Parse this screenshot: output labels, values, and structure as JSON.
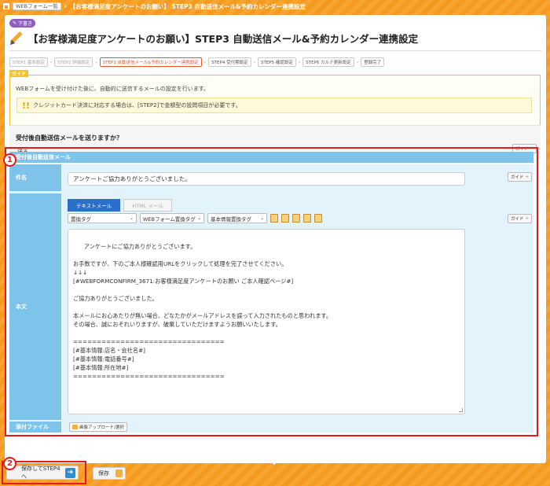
{
  "breadcrumb": {
    "root": "WEBフォーム一覧",
    "current": "【お客様満足度アンケートのお願い】 STEP3 自動送信メール&予約カレンダー連携設定"
  },
  "header": {
    "badge": "下書き",
    "title": "【お客様満足度アンケートのお願い】STEP3 自動送信メール&予約カレンダー連携設定"
  },
  "steps": [
    {
      "label": "STEP1 基本設定"
    },
    {
      "label": "STEP2 詳細設定"
    },
    {
      "label": "STEP3 自動送信メール&予約カレンダー連携設定"
    },
    {
      "label": "STEP4 受付期設定"
    },
    {
      "label": "STEP5 確認設定"
    },
    {
      "label": "STEP6 カルテ更新設定"
    },
    {
      "label": "登録完了"
    }
  ],
  "guide": {
    "tag": "ガイド",
    "text": "WEBフォームを受け付けた後に、自動的に送信するメールの設定を行います。",
    "notice": "クレジットカード決済に対応する場合は、[STEP2]で金額型の設問項目が必要です。"
  },
  "question": {
    "label": "受付後自動送信メールを送りますか？",
    "selected": "送る",
    "guide_btn": "ガイド"
  },
  "mail": {
    "header": "受付後自動送信メール",
    "subject_label": "件名",
    "subject_value": "アンケートご協力ありがとうございました。",
    "body_label": "本文",
    "attach_label": "添付ファイル",
    "guide_btn": "ガイド",
    "tabs": [
      "テキストメール",
      "HTML メール"
    ],
    "dropdowns": [
      "置換タグ",
      "WEBフォーム置換タグ",
      "基本情報置換タグ"
    ],
    "body_text": "アンケートにご協力ありがとうございます。\n\nお手数ですが、下のご本人様確認用URLをクリックして処理を完了させてください。\n↓↓↓\n[#WEBFORMCONFIRM_3671:お客様満足度アンケートのお願い ご本人確認ページ#]\n\nご協力ありがとうございました。\n\n本メールにお心あたりが無い場合、どなたかがメールアドレスを誤って入力されたものと思われます。\nその場合、誠におそれいりますが、破棄していただけますようお願いいたします。\n\n================================\n[#基本情報:店名・会社名#]\n[#基本情報:電話番号#]\n[#基本情報:所在地#]\n================================",
    "upload_btn": "画像アップロード/選択"
  },
  "markers": [
    "1",
    "2"
  ],
  "footer": {
    "next_label": "保存してSTEP4へ",
    "save_label": "保存"
  }
}
